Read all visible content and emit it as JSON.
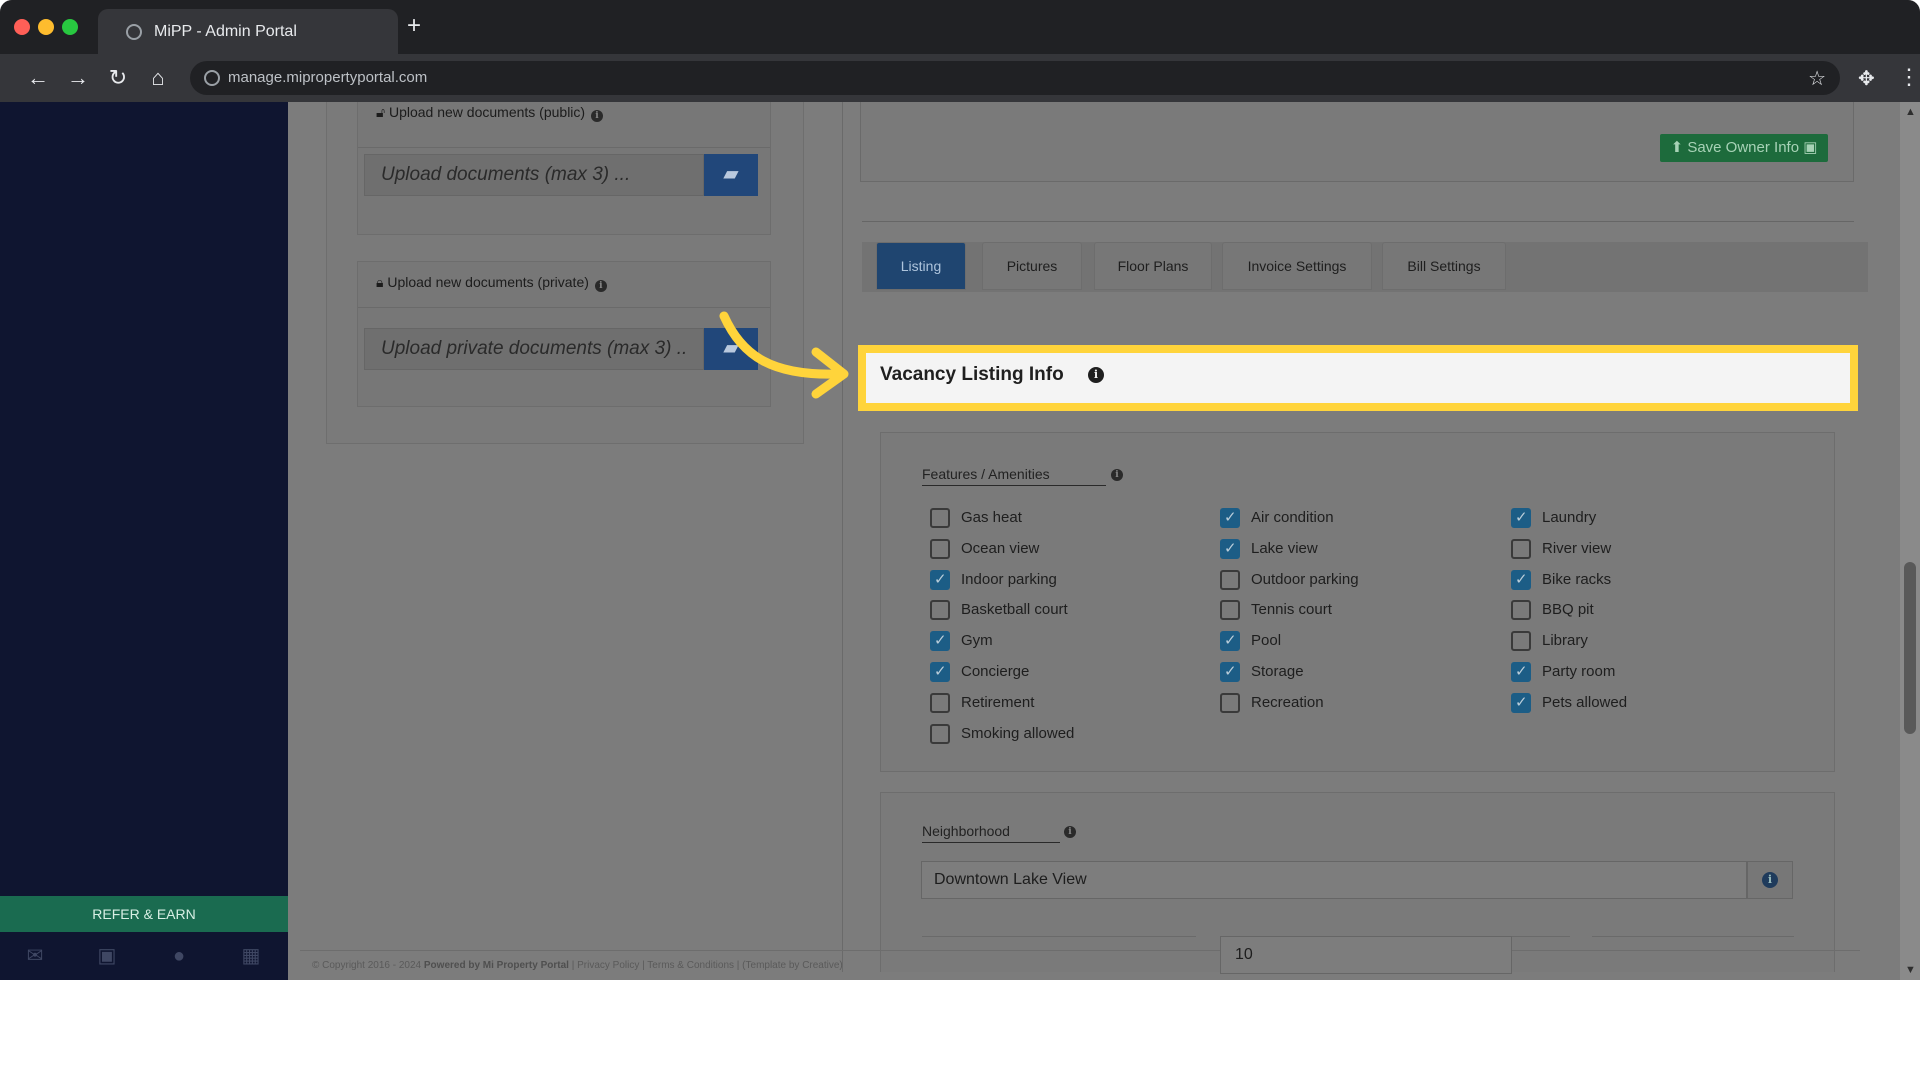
{
  "browser": {
    "tab_title": "MiPP - Admin Portal",
    "url": "manage.mipropertyportal.com",
    "traffic_colors": [
      "#ff5f57",
      "#febc2e",
      "#28c840"
    ]
  },
  "sidebar": {
    "refer_label": "REFER & EARN",
    "icons": [
      "envelope-icon",
      "briefcase-icon",
      "user-icon",
      "calendar-icon"
    ]
  },
  "documents": {
    "public_header": "Upload new documents (public)",
    "public_placeholder": "Upload documents (max 3) ...",
    "private_header": "Upload new documents (private)",
    "private_placeholder": "Upload private documents (max 3) .."
  },
  "owner": {
    "save_label": "Save Owner Info"
  },
  "tabs": [
    {
      "label": "Listing",
      "active": true
    },
    {
      "label": "Pictures",
      "active": false
    },
    {
      "label": "Floor Plans",
      "active": false
    },
    {
      "label": "Invoice Settings",
      "active": false
    },
    {
      "label": "Bill Settings",
      "active": false
    }
  ],
  "vacancy": {
    "title": "Vacancy Listing Info",
    "highlight_color": "#ffd43b"
  },
  "features": {
    "label": "Features / Amenities",
    "columns": [
      [
        {
          "label": "Gas heat",
          "checked": false
        },
        {
          "label": "Ocean view",
          "checked": false
        },
        {
          "label": "Indoor parking",
          "checked": true
        },
        {
          "label": "Basketball court",
          "checked": false
        },
        {
          "label": "Gym",
          "checked": true
        },
        {
          "label": "Concierge",
          "checked": true
        },
        {
          "label": "Retirement",
          "checked": false
        },
        {
          "label": "Smoking allowed",
          "checked": false
        }
      ],
      [
        {
          "label": "Air condition",
          "checked": true
        },
        {
          "label": "Lake view",
          "checked": true
        },
        {
          "label": "Outdoor parking",
          "checked": false
        },
        {
          "label": "Tennis court",
          "checked": false
        },
        {
          "label": "Pool",
          "checked": true
        },
        {
          "label": "Storage",
          "checked": true
        },
        {
          "label": "Recreation",
          "checked": false
        }
      ],
      [
        {
          "label": "Laundry",
          "checked": true
        },
        {
          "label": "River view",
          "checked": false
        },
        {
          "label": "Bike racks",
          "checked": true
        },
        {
          "label": "BBQ pit",
          "checked": false
        },
        {
          "label": "Library",
          "checked": false
        },
        {
          "label": "Party room",
          "checked": true
        },
        {
          "label": "Pets allowed",
          "checked": true
        }
      ]
    ]
  },
  "neighborhood": {
    "label": "Neighborhood",
    "value": "Downtown Lake View"
  },
  "bottom_field": {
    "value": "10"
  },
  "footer": {
    "copyright": "© Copyright 2016 - 2024",
    "powered": "Powered by Mi Property Portal",
    "links": "| Privacy Policy | Terms & Conditions |",
    "template": "(Template by Creative)"
  }
}
